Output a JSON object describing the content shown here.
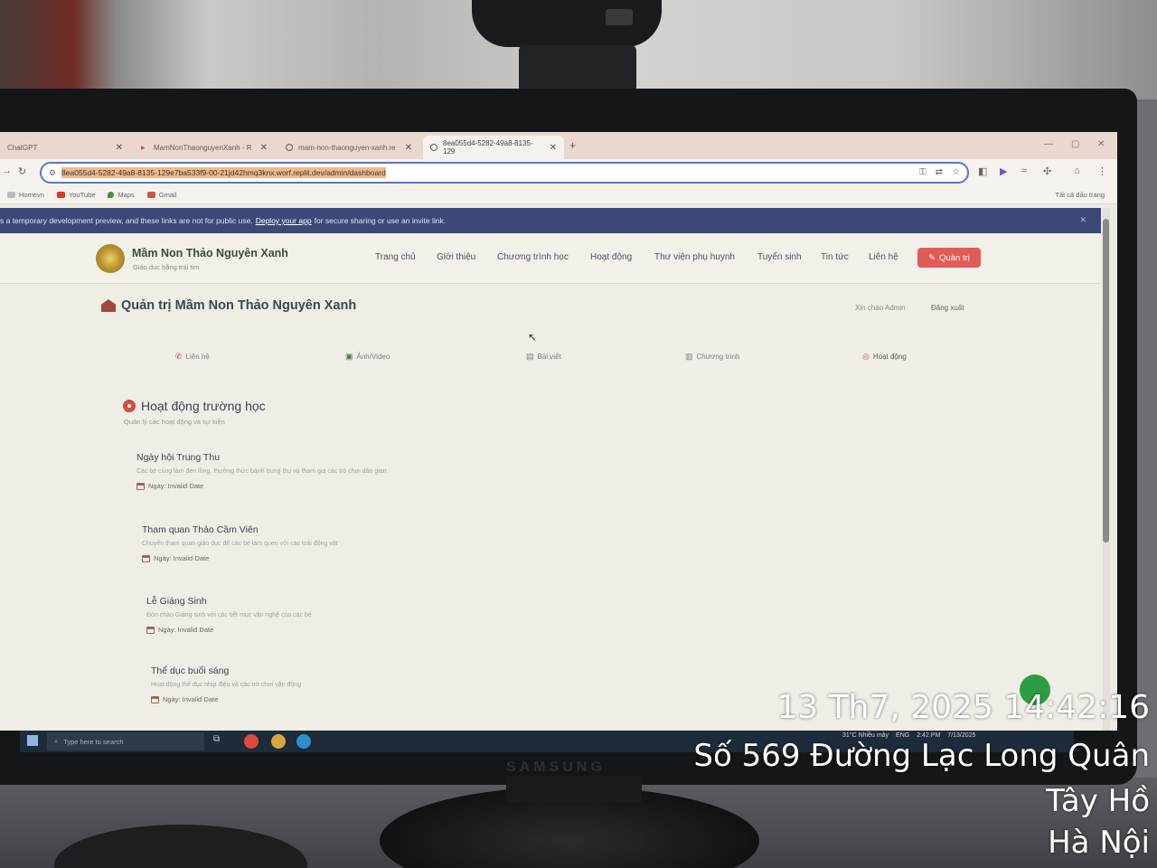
{
  "browser": {
    "tabs": [
      {
        "label": "ChatGPT"
      },
      {
        "label": "MamNonThaonguyenXanh - R"
      },
      {
        "label": "mam-non-thaonguyen-xanh.re"
      },
      {
        "label": "8ea055d4-5282-49a8-8135-129"
      }
    ],
    "url": "8ea055d4-5282-49a8-8135-129e7ba533f9-00-21jd42hmq3knx.worf.replit.dev/admin/dashboard",
    "bookmarks": [
      "Homevn",
      "YouTube",
      "Maps",
      "Gmail"
    ],
    "all_bookmarks": "Tất cả dấu trang"
  },
  "banner": {
    "text_before": "s a temporary development preview, and these links are not for public use.",
    "link": "Deploy your app",
    "text_after": "for secure sharing or use an invite link."
  },
  "site": {
    "name": "Mầm Non Thảo Nguyên Xanh",
    "tagline": "Giáo dục bằng trái tim",
    "menu": [
      "Trang chủ",
      "Giới thiệu",
      "Chương trình học",
      "Hoạt động",
      "Thư viện phụ huynh",
      "Tuyển sinh",
      "Tin tức",
      "Liên hệ"
    ],
    "admin_button": "Quản trị"
  },
  "admin": {
    "title": "Quản trị Mầm Non Thảo Nguyên Xanh",
    "greeting": "Xin chào Admin",
    "logout": "Đăng xuất",
    "tabs": [
      "Liên hệ",
      "Ảnh/Video",
      "Bài viết",
      "Chương trình",
      "Hoạt động"
    ],
    "active_tab": "Hoạt động"
  },
  "section": {
    "title": "Hoạt động trường học",
    "subtitle": "Quản lý các hoạt động và sự kiện"
  },
  "activities": [
    {
      "name": "Ngày hội Trung Thu",
      "desc": "Các bé cùng làm đèn lồng, thưởng thức bánh trung thu và tham gia các trò chơi dân gian",
      "date": "Ngày: Invalid Date"
    },
    {
      "name": "Tham quan Thảo Cầm Viên",
      "desc": "Chuyến tham quan giáo dục để các bé làm quen với các loài động vật",
      "date": "Ngày: Invalid Date"
    },
    {
      "name": "Lễ Giáng Sinh",
      "desc": "Đón chào Giáng sinh với các tiết mục văn nghệ của các bé",
      "date": "Ngày: Invalid Date"
    },
    {
      "name": "Thể dục buổi sáng",
      "desc": "Hoạt động thể dục nhịp điệu và các trò chơi vận động",
      "date": "Ngày: Invalid Date"
    }
  ],
  "taskbar": {
    "search_placeholder": "Type here to search",
    "weather": "31°C Nhiều mây",
    "lang": "ENG",
    "time": "2:42 PM",
    "date": "7/13/2025"
  },
  "monitor_brand": "SAMSUNG",
  "overlay": {
    "datetime": "13 Th7, 2025 14:42:16",
    "address": "Số 569 Đường Lạc Long Quân",
    "district": "Tây Hồ",
    "city": "Hà Nội"
  }
}
